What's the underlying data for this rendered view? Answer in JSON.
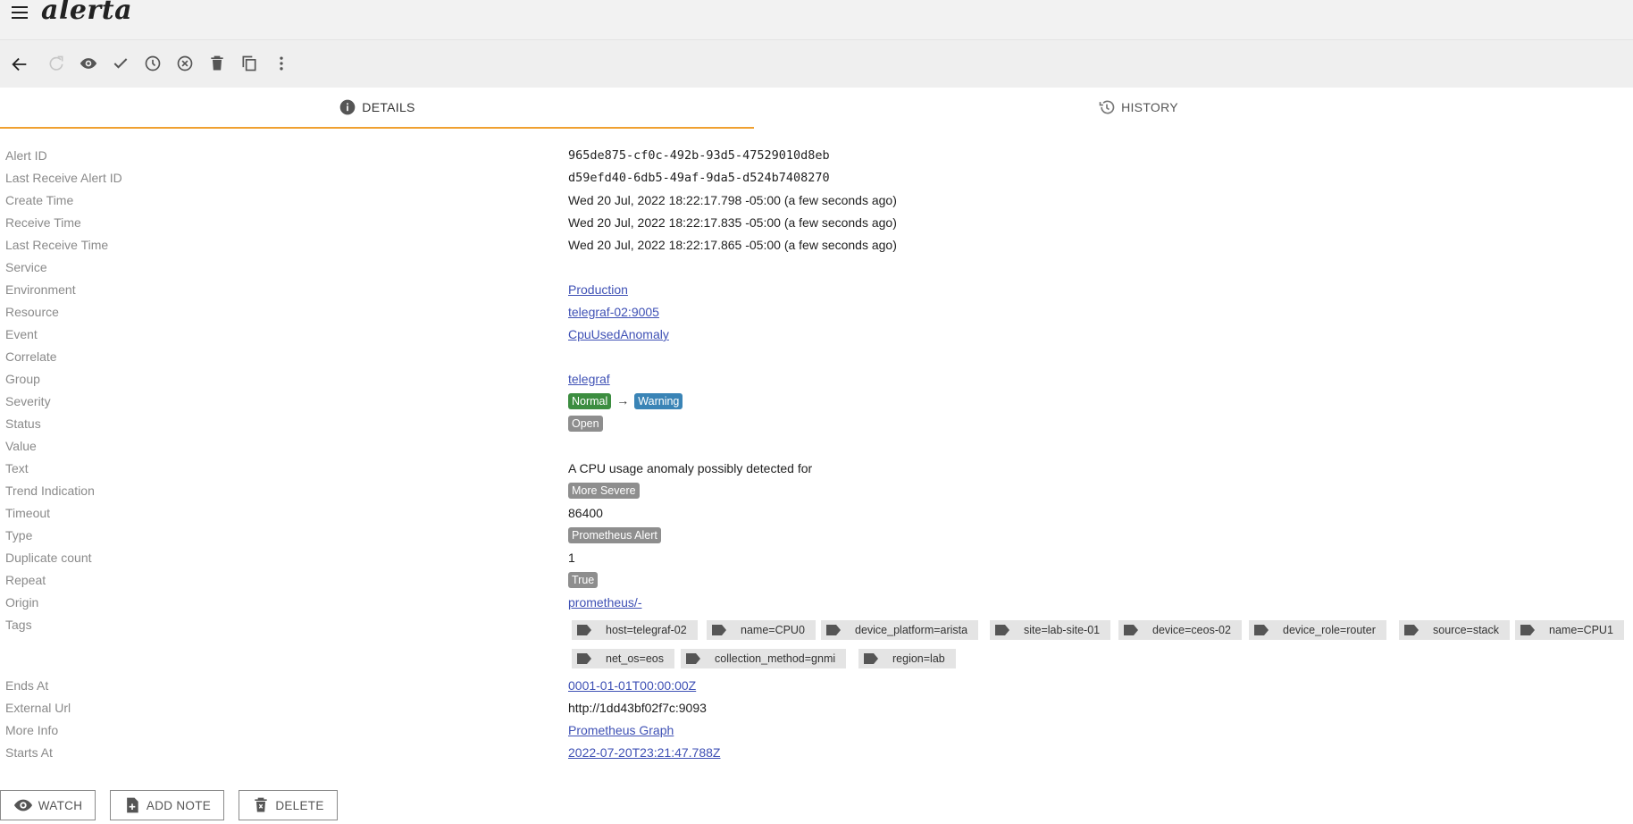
{
  "app": {
    "logo": "alerta"
  },
  "toolbar": {
    "icons": [
      "back-icon",
      "refresh-icon",
      "watch-icon",
      "ack-icon",
      "shelve-icon",
      "close-icon",
      "delete-icon",
      "copy-icon",
      "more-icon"
    ]
  },
  "tabs": [
    {
      "label": "DETAILS",
      "icon": "info-icon",
      "active": true
    },
    {
      "label": "HISTORY",
      "icon": "history-icon",
      "active": false
    }
  ],
  "details": {
    "alert_id": {
      "label": "Alert ID",
      "value": "965de875-cf0c-492b-93d5-47529010d8eb"
    },
    "last_receive_id": {
      "label": "Last Receive Alert ID",
      "value": "d59efd40-6db5-49af-9da5-d524b7408270"
    },
    "create_time": {
      "label": "Create Time",
      "value": "Wed 20 Jul, 2022 18:22:17.798 -05:00 (a few seconds ago)"
    },
    "receive_time": {
      "label": "Receive Time",
      "value": "Wed 20 Jul, 2022 18:22:17.835 -05:00 (a few seconds ago)"
    },
    "last_receive_time": {
      "label": "Last Receive Time",
      "value": "Wed 20 Jul, 2022 18:22:17.865 -05:00 (a few seconds ago)"
    },
    "service": {
      "label": "Service",
      "value": ""
    },
    "environment": {
      "label": "Environment",
      "value": "Production"
    },
    "resource": {
      "label": "Resource",
      "value": "telegraf-02:9005"
    },
    "event": {
      "label": "Event",
      "value": "CpuUsedAnomaly"
    },
    "correlate": {
      "label": "Correlate",
      "value": ""
    },
    "group": {
      "label": "Group",
      "value": "telegraf"
    },
    "severity": {
      "label": "Severity",
      "from": "Normal",
      "arrow": "→",
      "to": "Warning",
      "from_color": "#3c8d40",
      "to_color": "#3a84b6"
    },
    "status": {
      "label": "Status",
      "value": "Open"
    },
    "value": {
      "label": "Value",
      "value": ""
    },
    "text": {
      "label": "Text",
      "value": "A CPU usage anomaly possibly detected for"
    },
    "trend": {
      "label": "Trend Indication",
      "value": "More Severe"
    },
    "timeout": {
      "label": "Timeout",
      "value": "86400"
    },
    "type": {
      "label": "Type",
      "value": "Prometheus Alert"
    },
    "duplicate_count": {
      "label": "Duplicate count",
      "value": "1"
    },
    "repeat": {
      "label": "Repeat",
      "value": "True"
    },
    "origin": {
      "label": "Origin",
      "value": "prometheus/-"
    },
    "tags": {
      "label": "Tags",
      "items": [
        "host=telegraf-02",
        "name=CPU0",
        "device_platform=arista",
        "site=lab-site-01",
        "device=ceos-02",
        "device_role=router",
        "source=stack",
        "name=CPU1",
        "net_os=eos",
        "collection_method=gnmi",
        "region=lab"
      ]
    },
    "ends_at": {
      "label": "Ends At",
      "value": "0001-01-01T00:00:00Z"
    },
    "external_url": {
      "label": "External Url",
      "value": "http://1dd43bf02f7c:9093"
    },
    "more_info": {
      "label": "More Info",
      "value": "Prometheus Graph"
    },
    "starts_at": {
      "label": "Starts At",
      "value": "2022-07-20T23:21:47.788Z"
    }
  },
  "actions": {
    "watch": "WATCH",
    "add_note": "ADD NOTE",
    "delete": "DELETE"
  },
  "colors": {
    "accent": "#f0a030",
    "link": "#3f51b5",
    "badge_grey": "#8e8e8e"
  }
}
